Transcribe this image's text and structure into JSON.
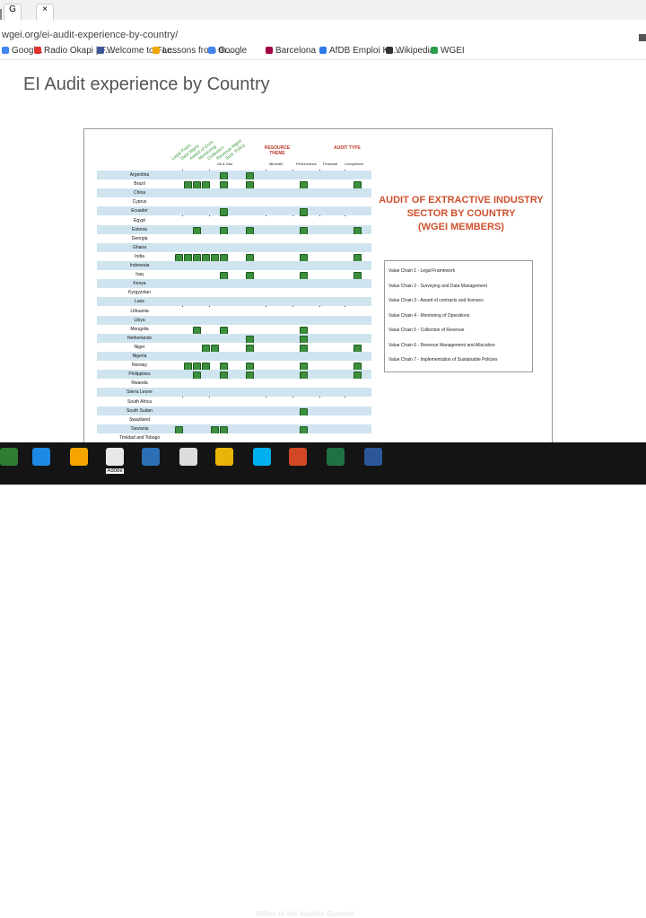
{
  "browser": {
    "tabs": [
      {
        "label": "G"
      },
      {
        "label": "×"
      }
    ],
    "address": "wgei.org/ei-audit-experience-by-country/",
    "bookmarks": [
      {
        "label": "Googl...",
        "color": "#4285f4"
      },
      {
        "label": "Radio Okapi | F...",
        "color": "#e0312b"
      },
      {
        "label": "Welcome to Fac...",
        "color": "#3b5998"
      },
      {
        "label": "Lessons from th...",
        "color": "#f0a500"
      },
      {
        "label": "Google",
        "color": "#4285f4"
      },
      {
        "label": "Barcelona",
        "color": "#a50044"
      },
      {
        "label": "AfDB Emploi Ku...",
        "color": "#2c7be5"
      },
      {
        "label": "Wikipedia",
        "color": "#333333"
      },
      {
        "label": "WGEI",
        "color": "#2b9e4a"
      }
    ]
  },
  "page": {
    "title": "EI Audit experience by Country"
  },
  "doc": {
    "value_chain_headers": [
      "Legal Fram.",
      "Data Mgmt",
      "Award of Cont.",
      "Monitoring",
      "Collection",
      "Revenue Mgmt",
      "Sust. Policy"
    ],
    "resource_theme_label": "RESOURCE THEME",
    "audit_type_label": "AUDIT TYPE",
    "sub_headers": [
      "Oil & Gas",
      "Minerals",
      "Performance",
      "Financial",
      "Compliance"
    ],
    "countries": [
      {
        "name": "Argentina",
        "checks": [
          0,
          0,
          0,
          0,
          0,
          1,
          0,
          1,
          0,
          0,
          0,
          0
        ]
      },
      {
        "name": "Brazil",
        "checks": [
          0,
          1,
          1,
          1,
          0,
          1,
          0,
          1,
          0,
          1,
          0,
          1
        ]
      },
      {
        "name": "China",
        "checks": [
          0,
          0,
          0,
          0,
          0,
          0,
          0,
          0,
          0,
          0,
          0,
          0
        ]
      },
      {
        "name": "Cyprus",
        "checks": [
          0,
          0,
          0,
          0,
          0,
          0,
          0,
          0,
          0,
          0,
          0,
          0
        ]
      },
      {
        "name": "Ecuador",
        "checks": [
          0,
          0,
          0,
          0,
          0,
          1,
          0,
          0,
          0,
          1,
          0,
          0
        ]
      },
      {
        "name": "Egypt",
        "checks": [
          0,
          0,
          0,
          0,
          0,
          0,
          0,
          0,
          0,
          0,
          0,
          0
        ]
      },
      {
        "name": "Estonia",
        "checks": [
          0,
          0,
          1,
          0,
          0,
          1,
          0,
          1,
          0,
          1,
          0,
          1
        ]
      },
      {
        "name": "Georgia",
        "checks": [
          0,
          0,
          0,
          0,
          0,
          0,
          0,
          0,
          0,
          0,
          0,
          0
        ]
      },
      {
        "name": "Ghana",
        "checks": [
          0,
          0,
          0,
          0,
          0,
          0,
          0,
          0,
          0,
          0,
          0,
          0
        ]
      },
      {
        "name": "India",
        "checks": [
          1,
          1,
          1,
          1,
          1,
          1,
          0,
          1,
          0,
          1,
          0,
          1
        ]
      },
      {
        "name": "Indonesia",
        "checks": [
          0,
          0,
          0,
          0,
          0,
          0,
          0,
          0,
          0,
          0,
          0,
          0
        ]
      },
      {
        "name": "Iraq",
        "checks": [
          0,
          0,
          0,
          0,
          0,
          1,
          0,
          1,
          0,
          1,
          0,
          1
        ]
      },
      {
        "name": "Kenya",
        "checks": [
          0,
          0,
          0,
          0,
          0,
          0,
          0,
          0,
          0,
          0,
          0,
          0
        ]
      },
      {
        "name": "Kyrgyzstan",
        "checks": [
          0,
          0,
          0,
          0,
          0,
          0,
          0,
          0,
          0,
          0,
          0,
          0
        ]
      },
      {
        "name": "Laos",
        "checks": [
          0,
          0,
          0,
          0,
          0,
          0,
          0,
          0,
          0,
          0,
          0,
          0
        ]
      },
      {
        "name": "Lithuania",
        "checks": [
          0,
          0,
          0,
          0,
          0,
          0,
          0,
          0,
          0,
          0,
          0,
          0
        ]
      },
      {
        "name": "Libya",
        "checks": [
          0,
          0,
          0,
          0,
          0,
          0,
          0,
          0,
          0,
          0,
          0,
          0
        ]
      },
      {
        "name": "Mongolia",
        "checks": [
          0,
          0,
          1,
          0,
          0,
          1,
          0,
          0,
          0,
          1,
          0,
          0
        ]
      },
      {
        "name": "Netherlands",
        "checks": [
          0,
          0,
          0,
          0,
          0,
          0,
          0,
          1,
          0,
          1,
          0,
          0
        ]
      },
      {
        "name": "Niger",
        "checks": [
          0,
          0,
          0,
          1,
          1,
          0,
          0,
          1,
          0,
          1,
          0,
          1
        ]
      },
      {
        "name": "Nigeria",
        "checks": [
          0,
          0,
          0,
          0,
          0,
          0,
          0,
          0,
          0,
          0,
          0,
          0
        ]
      },
      {
        "name": "Norway",
        "checks": [
          0,
          1,
          1,
          1,
          0,
          1,
          0,
          1,
          0,
          1,
          0,
          1
        ]
      },
      {
        "name": "Philippines",
        "checks": [
          0,
          0,
          1,
          0,
          0,
          1,
          0,
          1,
          0,
          1,
          0,
          1
        ]
      },
      {
        "name": "Rwanda",
        "checks": [
          0,
          0,
          0,
          0,
          0,
          0,
          0,
          0,
          0,
          0,
          0,
          0
        ]
      },
      {
        "name": "Sierra Leone",
        "checks": [
          0,
          0,
          0,
          0,
          0,
          0,
          0,
          0,
          0,
          0,
          0,
          0
        ]
      },
      {
        "name": "South Africa",
        "checks": [
          0,
          0,
          0,
          0,
          0,
          0,
          0,
          0,
          0,
          0,
          0,
          0
        ]
      },
      {
        "name": "South Sudan",
        "checks": [
          0,
          0,
          0,
          0,
          0,
          0,
          0,
          0,
          0,
          1,
          0,
          0
        ]
      },
      {
        "name": "Swaziland",
        "checks": [
          0,
          0,
          0,
          0,
          0,
          0,
          0,
          0,
          0,
          0,
          0,
          0
        ]
      },
      {
        "name": "Tanzania",
        "checks": [
          1,
          0,
          0,
          0,
          1,
          1,
          0,
          0,
          0,
          1,
          0,
          0
        ]
      },
      {
        "name": "Trinidad and Tobago",
        "checks": [
          0,
          0,
          0,
          0,
          0,
          0,
          0,
          0,
          0,
          0,
          0,
          0
        ]
      }
    ],
    "title_lines": [
      "AUDIT OF EXTRACTIVE INDUSTRY",
      "SECTOR BY COUNTRY",
      "(WGEI MEMBERS)"
    ],
    "value_chains": [
      "Value Chain 1 - Legal Framework",
      "Value Chain 2 - Surveying and Data Management",
      "Value Chain 3 - Award of contracts and licenses",
      "Value Chain 4 - Monitoring of Operations",
      "Value Chain 5 - Collection of Revenue",
      "Value Chain 6 - Revenue Management and Allocation",
      "Value Chain 7 - Implementation of Sustainable Policies"
    ]
  },
  "taskbar": {
    "apps": [
      {
        "name": "store",
        "color": "#2d7d32"
      },
      {
        "name": "mail",
        "color": "#1e88e5"
      },
      {
        "name": "audio",
        "color": "#f6a500"
      },
      {
        "name": "adobe",
        "color": "#e8e8e8"
      },
      {
        "name": "monitor",
        "color": "#2c6fb5"
      },
      {
        "name": "home",
        "color": "#dddddd"
      },
      {
        "name": "chrome",
        "color": "#eab308"
      },
      {
        "name": "skype",
        "color": "#00aff0"
      },
      {
        "name": "powerpoint",
        "color": "#d24726"
      },
      {
        "name": "excel",
        "color": "#1f7244"
      },
      {
        "name": "word",
        "color": "#2b579a"
      }
    ],
    "adobe_label": "Adobe",
    "footer_text": "Office of the Auditor General"
  }
}
